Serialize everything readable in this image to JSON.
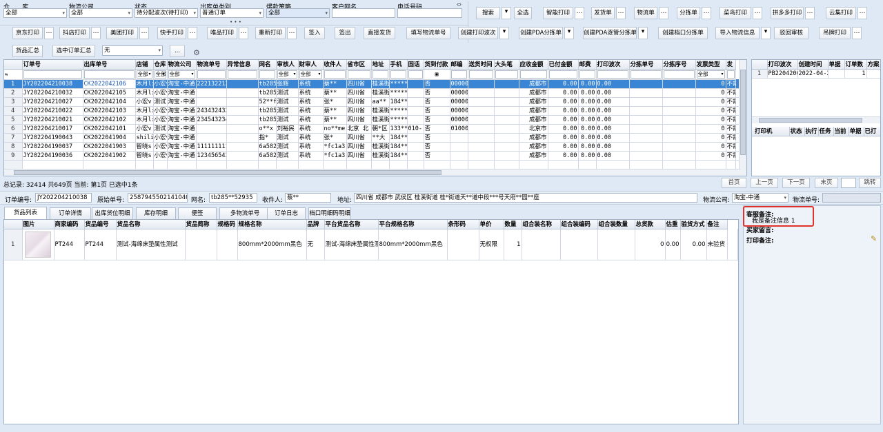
{
  "filters": {
    "warehouse": {
      "label": "仓　　库",
      "value": "全部"
    },
    "logistics": {
      "label": "物流公司",
      "value": "全部"
    },
    "status": {
      "label": "状态",
      "value": "待分配波次(待打印)"
    },
    "outbound_type": {
      "label": "出库单类别",
      "value": "普通订单"
    },
    "hot_strategy": {
      "label": "爆款策略",
      "value": "全部"
    },
    "customer_nick": {
      "label": "客户网名",
      "value": ""
    },
    "phone": {
      "label": "电话号码",
      "value": ""
    },
    "more": "• • •",
    "collapse_icon": "collapse-icon"
  },
  "toolbar": {
    "row1": [
      {
        "label": "搜索",
        "more": "▾"
      },
      {
        "label": "全选",
        "more": ""
      },
      {
        "label": "智能打印",
        "more": "…"
      },
      {
        "label": "发货单",
        "more": "…"
      },
      {
        "label": "物流单",
        "more": "…"
      },
      {
        "label": "分拣单",
        "more": "…"
      },
      {
        "label": "菜鸟打印",
        "more": "…"
      },
      {
        "label": "拼多多打印",
        "more": "…"
      },
      {
        "label": "云集打印",
        "more": "…"
      }
    ],
    "row2": [
      {
        "label": "京东打印",
        "more": "…"
      },
      {
        "label": "抖店打印",
        "more": "…"
      },
      {
        "label": "美团打印",
        "more": "…"
      },
      {
        "label": "快手打印",
        "more": "…"
      },
      {
        "label": "唯品打印",
        "more": "…"
      },
      {
        "label": "重新打印",
        "more": "…"
      },
      {
        "label": "签入",
        "more": ""
      },
      {
        "label": "签出",
        "more": ""
      },
      {
        "label": "直接发货",
        "more": ""
      },
      {
        "label": "填写物流单号",
        "more": ""
      },
      {
        "label": "创建打印波次",
        "more": "▾"
      },
      {
        "label": "创建PDA分拣单",
        "more": "▾"
      },
      {
        "label": "创建PDA逐管分拣单",
        "more": "▾"
      },
      {
        "label": "创建档口分拣单",
        "more": ""
      },
      {
        "label": "导入物流信息",
        "more": "▾"
      },
      {
        "label": "驳回审核",
        "more": ""
      },
      {
        "label": "吊牌打印",
        "more": "…"
      }
    ],
    "row3": {
      "summary": "货品汇总",
      "selected_summary": "选中订单汇总",
      "select_value": "无",
      "dots": "...",
      "gear_icon": "gear-icon"
    }
  },
  "orders": {
    "columns": [
      "订单号",
      "出库单号",
      "店铺",
      "仓库",
      "物流公司",
      "物流单号",
      "异常信息",
      "网名",
      "审核人",
      "财审人",
      "收件人",
      "省市区",
      "地址",
      "手机",
      "固话",
      "货到付款",
      "邮编",
      "送货时间",
      "大头笔",
      "应收金额",
      "已付金额",
      "邮费",
      "打印波次",
      "分拣单号",
      "分拣序号",
      "发票类型",
      "发"
    ],
    "filter_row": {
      "shop": "全部",
      "warehouse": "全部",
      "logistics": "全部",
      "reviewer": "全部",
      "fin_reviewer": "全部",
      "invoice": "全部"
    },
    "rows": [
      [
        "1",
        "JY202204210038",
        "CK2022042106",
        "木月lii",
        "小宏v",
        "淘宝-中通",
        "222132213",
        "",
        "tb285",
        "张辉",
        "系统",
        "蔡**",
        "四川省",
        "桂溪街",
        "*****",
        "",
        "否",
        "00000",
        "",
        "",
        "成都市",
        "0.00",
        "0.00",
        "0.00",
        "",
        "",
        "0",
        "不需要"
      ],
      [
        "2",
        "JY202204210032",
        "CK2022042105",
        "木月lii",
        "小宏v",
        "淘宝-中通",
        "",
        "",
        "tb285",
        "测试",
        "系统",
        "蔡**",
        "四川省",
        "桂溪街",
        "*****",
        "",
        "否",
        "00000",
        "",
        "",
        "成都市",
        "0.00",
        "0.00",
        "0.00",
        "",
        "",
        "0",
        "不需要"
      ],
      [
        "3",
        "JY202204210027",
        "CK2022042104",
        "小宏v",
        "测试",
        "淘宝-中通",
        "",
        "",
        "52**f",
        "测试",
        "系统",
        "张*",
        "四川省",
        "aa**",
        "184**",
        "",
        "否",
        "00000",
        "",
        "",
        "成都市",
        "0.00",
        "0.00",
        "0.00",
        "",
        "",
        "0",
        "不需要"
      ],
      [
        "4",
        "JY202204210022",
        "CK2022042103",
        "木月lii",
        "小宏v",
        "淘宝-中通",
        "243432432",
        "",
        "tb285",
        "测试",
        "系统",
        "蔡**",
        "四川省",
        "桂溪街",
        "*****",
        "",
        "否",
        "00000",
        "",
        "",
        "成都市",
        "0.00",
        "0.00",
        "0.00",
        "",
        "",
        "0",
        "不需要"
      ],
      [
        "5",
        "JY202204210021",
        "CK2022042102",
        "木月lii",
        "小宏v",
        "淘宝-中通",
        "234543234",
        "",
        "tb285",
        "测试",
        "系统",
        "蔡**",
        "四川省",
        "桂溪街",
        "*****",
        "",
        "否",
        "00000",
        "",
        "",
        "成都市",
        "0.00",
        "0.00",
        "0.00",
        "",
        "",
        "0",
        "不需要"
      ],
      [
        "6",
        "JY202204210017",
        "CK2022042101",
        "小宏v",
        "测试",
        "淘宝-中通",
        "",
        "",
        "o**x",
        "刘裕民",
        "系统",
        "no**me",
        "北京 北",
        "朝*区",
        "133**",
        "010-",
        "否",
        "01000",
        "",
        "",
        "北京市",
        "0.00",
        "0.00",
        "0.00",
        "",
        "",
        "0",
        "不需要"
      ],
      [
        "7",
        "JY202204190043",
        "CK2022041904",
        "shili",
        "小宏v",
        "淘宝-中通",
        "",
        "",
        "指*",
        "测试",
        "系统",
        "张*",
        "四川省",
        "**大",
        "184**",
        "",
        "否",
        "",
        "",
        "",
        "成都市",
        "0.00",
        "0.00",
        "0.00",
        "",
        "",
        "0",
        "不需要"
      ],
      [
        "8",
        "JY202204190037",
        "CK2022041903",
        "智晓s",
        "小宏v",
        "淘宝-中通",
        "111111111",
        "",
        "6a582",
        "测试",
        "系统",
        "*fc1a3",
        "四川省",
        "桂溪街",
        "184**",
        "",
        "否",
        "",
        "",
        "",
        "成都市",
        "0.00",
        "0.00",
        "0.00",
        "",
        "",
        "0",
        "不需要"
      ],
      [
        "9",
        "JY202204190036",
        "CK2022041902",
        "智晓s",
        "小宏v",
        "淘宝-中通",
        "123456543",
        "",
        "6a582",
        "测试",
        "系统",
        "*fc1a3",
        "四川省",
        "桂溪街",
        "184**",
        "",
        "否",
        "",
        "",
        "",
        "成都市",
        "0.00",
        "0.00",
        "0.00",
        "",
        "",
        "0",
        "不需要"
      ]
    ]
  },
  "waves": {
    "columns": [
      "打印波次",
      "创建时间",
      "单据",
      "订单数",
      "方案"
    ],
    "rows": [
      [
        "1",
        "PB2204200",
        "2022-04-2",
        "",
        "1",
        ""
      ]
    ],
    "printer_columns": [
      "打印机",
      "状态",
      "执行",
      "任务",
      "当前",
      "单据",
      "已打"
    ]
  },
  "status_bar": {
    "text": "总记录: 32414  共649页  当前: 第1页  已选中1条",
    "first": "首页",
    "prev": "上一页",
    "next": "下一页",
    "last": "末页",
    "jump": "跳转"
  },
  "detail": {
    "order_no_label": "订单编号:",
    "order_no": "JY202204210038",
    "orig_no_label": "原始单号:",
    "orig_no": "2587945502141040",
    "nick_label": "网名:",
    "nick": "tb285**52935",
    "receiver_label": "收件人:",
    "receiver": "蔡**",
    "address_label": "地址:",
    "address": "四川省 成都市 武侯区 桂溪街道 桂*街道天**道中段***号天府**园**座",
    "logistics_label": "物流公司:",
    "logistics": "淘宝-中通",
    "logistics_no_label": "物流单号:",
    "logistics_no": ""
  },
  "tabs": [
    "货品列表",
    "订单详情",
    "出库货位明细",
    "库存明细",
    "便签",
    "多物流单号",
    "订单日志",
    "档口明细码明细"
  ],
  "goods": {
    "columns": [
      "图片",
      "商家编码",
      "货品编号",
      "货品名称",
      "货品简称",
      "规格码",
      "规格名称",
      "品牌",
      "平台货品名称",
      "平台规格名称",
      "条形码",
      "单价",
      "数量",
      "组合装名称",
      "组合装编码",
      "组合装数量",
      "总货款",
      "估重",
      "验货方式",
      "备注"
    ],
    "rows": [
      [
        "1",
        "",
        "PT244",
        "PT244",
        "测试-海绵床垫属性测试",
        "",
        "",
        "800mm*2000mm黑色",
        "无",
        "测试-海绵床垫属性测试",
        "800mm*2000mm黑色",
        "",
        "无权限",
        "1",
        "",
        "",
        "",
        "0",
        "0.00",
        "0.00",
        "未验货",
        ""
      ]
    ]
  },
  "remarks": {
    "service_label": "客服备注:",
    "service_text": "我是备注信息 1",
    "buyer_label": "买家留言:",
    "print_label": "打印备注:",
    "edit_icon": "edit-icon",
    "highlight_color": "#e0312a"
  },
  "colors": {
    "accent": "#3a86d4",
    "background": "#dfe9f5"
  }
}
